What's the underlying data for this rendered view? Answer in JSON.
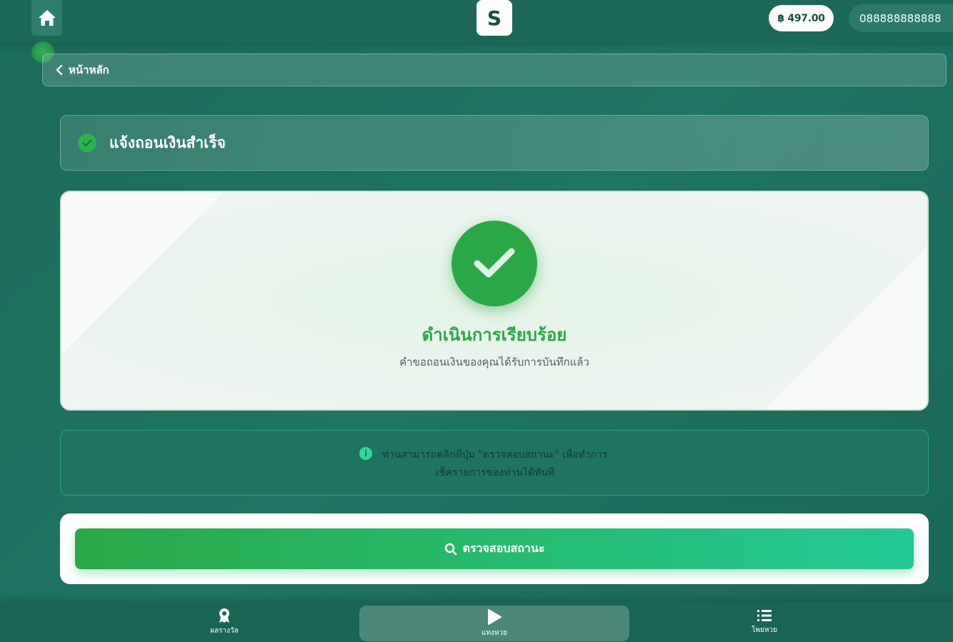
{
  "header": {
    "home_icon": "home-icon",
    "logo_letter": "S",
    "balance": "฿ 497.00",
    "account": "088888888888"
  },
  "breadcrumb": {
    "back_label": "หน้าหลัก"
  },
  "title_card": {
    "title": "แจ้งถอนเงินสำเร็จ"
  },
  "success": {
    "heading": "ดำเนินการเรียบร้อย",
    "subtext": "คำขอถอนเงินของคุณได้รับการบันทึกแล้ว"
  },
  "info": {
    "line1": "ท่านสามารถคลิกที่ปุ่ม \"ตรวจสอบสถานะ\" เพื่อทำการ",
    "line2": "เช็ครายการของท่านได้ทันที"
  },
  "actions": {
    "check_status_label": "ตรวจสอบสถานะ"
  },
  "bottom_nav": {
    "items": [
      {
        "label": "ผลรางวัล",
        "icon": "award-icon"
      },
      {
        "label": "แทงหวย",
        "icon": "play-icon"
      },
      {
        "label": "โพยหวย",
        "icon": "list-icon"
      }
    ]
  },
  "colors": {
    "brand_green": "#2aa845",
    "accent_teal": "#22c995",
    "background": "#1c6b5a"
  }
}
